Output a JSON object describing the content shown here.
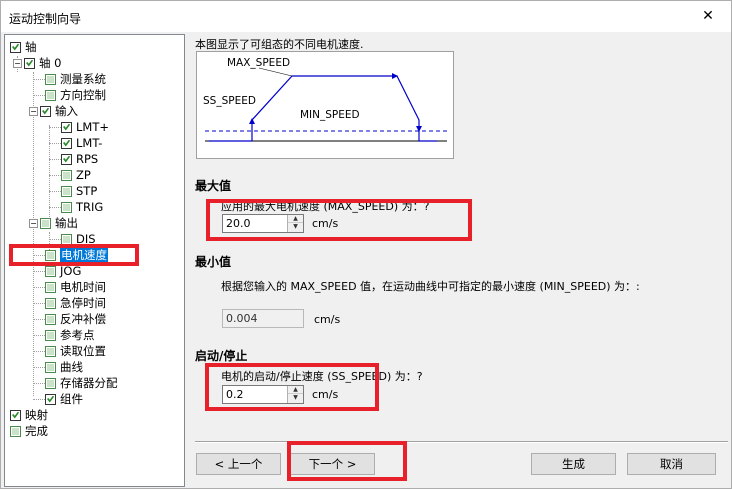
{
  "window": {
    "title": "运动控制向导",
    "close_glyph": "✕"
  },
  "tree": {
    "items": [
      {
        "label": "轴",
        "checked": true
      },
      {
        "label": "轴 0",
        "checked": true
      },
      {
        "label": "测量系统",
        "checked": false
      },
      {
        "label": "方向控制",
        "checked": false
      },
      {
        "label": "输入",
        "checked": true
      },
      {
        "label": "LMT+",
        "checked": true
      },
      {
        "label": "LMT-",
        "checked": true
      },
      {
        "label": "RPS",
        "checked": true
      },
      {
        "label": "ZP",
        "checked": false
      },
      {
        "label": "STP",
        "checked": false
      },
      {
        "label": "TRIG",
        "checked": false
      },
      {
        "label": "输出",
        "checked": false
      },
      {
        "label": "DIS",
        "checked": false
      },
      {
        "label": "电机速度",
        "checked": false
      },
      {
        "label": "JOG",
        "checked": false
      },
      {
        "label": "电机时间",
        "checked": false
      },
      {
        "label": "急停时间",
        "checked": false
      },
      {
        "label": "反冲补偿",
        "checked": false
      },
      {
        "label": "参考点",
        "checked": false
      },
      {
        "label": "读取位置",
        "checked": false
      },
      {
        "label": "曲线",
        "checked": false
      },
      {
        "label": "存储器分配",
        "checked": false
      },
      {
        "label": "组件",
        "checked": true
      },
      {
        "label": "映射",
        "checked": true
      },
      {
        "label": "完成",
        "checked": false
      }
    ]
  },
  "panel": {
    "description": "本图显示了可组态的不同电机速度.",
    "diagram": {
      "max_label": "MAX_SPEED",
      "ss_label": "SS_SPEED",
      "min_label": "MIN_SPEED"
    },
    "max": {
      "heading": "最大值",
      "prompt": "应用的最大电机速度 (MAX_SPEED) 为：?",
      "value": "20.0",
      "unit": "cm/s"
    },
    "min": {
      "heading": "最小值",
      "prompt": "根据您输入的 MAX_SPEED 值，在运动曲线中可指定的最小速度 (MIN_SPEED) 为：:",
      "value": "0.004",
      "unit": "cm/s"
    },
    "startstop": {
      "heading": "启动/停止",
      "prompt": "电机的启动/停止速度 (SS_SPEED) 为：?",
      "value": "0.2",
      "unit": "cm/s"
    }
  },
  "buttons": {
    "prev": "< 上一个",
    "next": "下一个 >",
    "finish": "生成",
    "cancel": "取消"
  },
  "colors": {
    "highlight": "#e8202a",
    "selection": "#0078d7",
    "check": "#2a8a2a"
  }
}
